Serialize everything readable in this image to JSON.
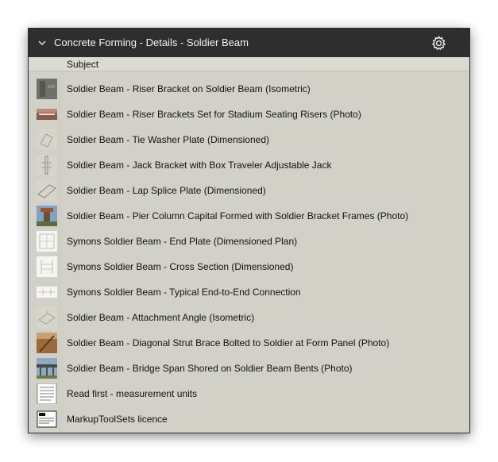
{
  "panel": {
    "title": "Concrete Forming - Details - Soldier Beam",
    "column_header": "Subject"
  },
  "items": [
    {
      "label": "Soldier Beam - Riser Bracket on Soldier Beam (Isometric)",
      "thumb": "photo-gray"
    },
    {
      "label": "Soldier Beam - Riser Brackets Set for Stadium Seating Risers (Photo)",
      "thumb": "photo-red"
    },
    {
      "label": "Soldier Beam - Tie Washer Plate (Dimensioned)",
      "thumb": "drawing-faint"
    },
    {
      "label": "Soldier Beam - Jack Bracket with Box Traveler Adjustable Jack",
      "thumb": "drawing-vertical"
    },
    {
      "label": "Soldier Beam - Lap Splice Plate (Dimensioned)",
      "thumb": "drawing-iso"
    },
    {
      "label": "Soldier Beam - Pier Column Capital Formed with Soldier Bracket Frames (Photo)",
      "thumb": "photo-column"
    },
    {
      "label": "Symons Soldier Beam - End Plate (Dimensioned Plan)",
      "thumb": "drawing-plan"
    },
    {
      "label": "Symons Soldier Beam - Cross Section (Dimensioned)",
      "thumb": "drawing-section"
    },
    {
      "label": "Symons Soldier Beam - Typical End-to-End Connection",
      "thumb": "drawing-connection"
    },
    {
      "label": "Soldier Beam - Attachment Angle (Isometric)",
      "thumb": "drawing-angle"
    },
    {
      "label": "Soldier Beam - Diagonal Strut Brace Bolted to Soldier at Form Panel (Photo)",
      "thumb": "photo-brown"
    },
    {
      "label": "Soldier Beam - Bridge Span Shored on Soldier Beam Bents (Photo)",
      "thumb": "photo-bridge"
    },
    {
      "label": "Read first - measurement units",
      "thumb": "doc-page"
    },
    {
      "label": "MarkupToolSets licence",
      "thumb": "doc-licence"
    }
  ]
}
